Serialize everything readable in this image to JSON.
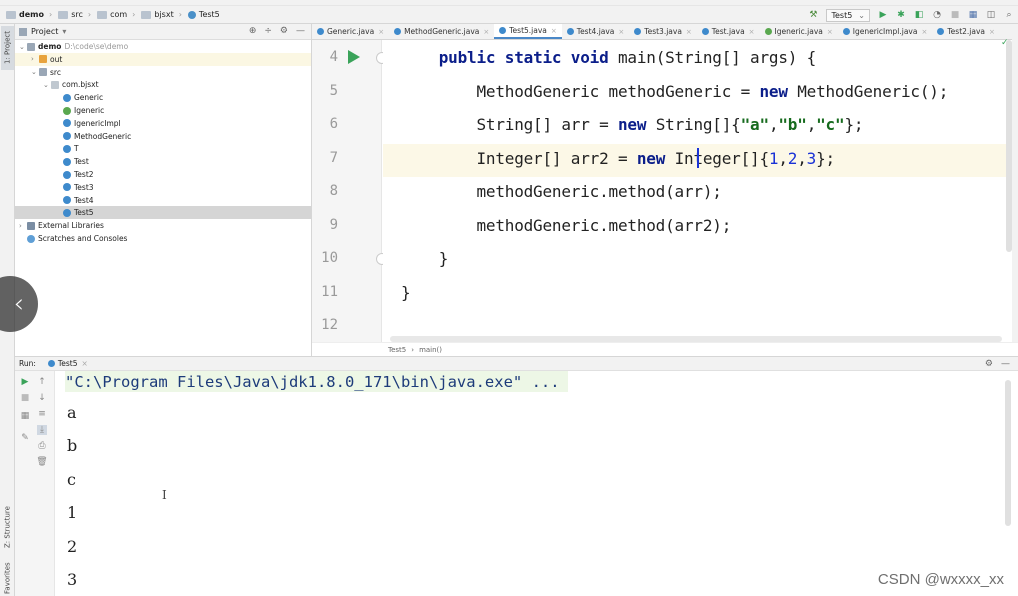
{
  "breadcrumb": [
    "demo",
    "src",
    "com",
    "bjsxt",
    "Test5"
  ],
  "run_config": "Test5",
  "project_panel": {
    "title": "Project",
    "tree": [
      {
        "label": "demo",
        "note": "D:\\code\\se\\demo",
        "depth": 0,
        "type": "folder",
        "expanded": true
      },
      {
        "label": "out",
        "depth": 1,
        "type": "ofolder",
        "expanded": false
      },
      {
        "label": "src",
        "depth": 1,
        "type": "folder",
        "expanded": true
      },
      {
        "label": "com.bjsxt",
        "depth": 2,
        "type": "pkg",
        "expanded": true
      },
      {
        "label": "Generic",
        "depth": 3,
        "type": "cls"
      },
      {
        "label": "Igeneric",
        "depth": 3,
        "type": "intf"
      },
      {
        "label": "IgenericImpl",
        "depth": 3,
        "type": "cls"
      },
      {
        "label": "MethodGeneric",
        "depth": 3,
        "type": "cls"
      },
      {
        "label": "T",
        "depth": 3,
        "type": "cls"
      },
      {
        "label": "Test",
        "depth": 3,
        "type": "cls"
      },
      {
        "label": "Test2",
        "depth": 3,
        "type": "cls"
      },
      {
        "label": "Test3",
        "depth": 3,
        "type": "cls"
      },
      {
        "label": "Test4",
        "depth": 3,
        "type": "cls"
      },
      {
        "label": "Test5",
        "depth": 3,
        "type": "cls",
        "selected": true
      },
      {
        "label": "External Libraries",
        "depth": 0,
        "type": "lib",
        "expanded": false
      },
      {
        "label": "Scratches and Consoles",
        "depth": 0,
        "type": "scr"
      }
    ]
  },
  "tabs": [
    {
      "label": "Generic.java",
      "icon": "class-icon"
    },
    {
      "label": "MethodGeneric.java",
      "icon": "class-icon"
    },
    {
      "label": "Test5.java",
      "icon": "class-icon",
      "active": true
    },
    {
      "label": "Test4.java",
      "icon": "class-icon"
    },
    {
      "label": "Test3.java",
      "icon": "class-icon"
    },
    {
      "label": "Test.java",
      "icon": "class-icon"
    },
    {
      "label": "Igeneric.java",
      "icon": "interface-icon"
    },
    {
      "label": "IgenericImpl.java",
      "icon": "class-icon"
    },
    {
      "label": "Test2.java",
      "icon": "class-icon"
    }
  ],
  "code_lines": [
    {
      "num": "4",
      "html": "    <span class=\"kw\">public static void</span> main(String[] args) {"
    },
    {
      "num": "5",
      "html": "        MethodGeneric methodGeneric = <span class=\"kw\">new</span> MethodGeneric();"
    },
    {
      "num": "6",
      "html": "        String[] arr = <span class=\"kw\">new</span> String[]{<span class=\"str\">\"a\"</span>,<span class=\"str\">\"b\"</span>,<span class=\"str\">\"c\"</span>};"
    },
    {
      "num": "7",
      "html": "        Integer[] arr2 = <span class=\"kw\">new</span> Integer[]{<span class=\"num\">1</span>,<span class=\"num\">2</span>,<span class=\"num\">3</span>};"
    },
    {
      "num": "8",
      "html": "        methodGeneric.method(arr);"
    },
    {
      "num": "9",
      "html": "        methodGeneric.method(arr2);"
    },
    {
      "num": "10",
      "html": "    }"
    },
    {
      "num": "11",
      "html": "}"
    },
    {
      "num": "12",
      "html": ""
    }
  ],
  "editor_breadcrumb": [
    "Test5",
    "main()"
  ],
  "run_panel": {
    "label": "Run:",
    "tab": "Test5",
    "command": "\"C:\\Program Files\\Java\\jdk1.8.0_171\\bin\\java.exe\" ...",
    "output": [
      "a",
      "b",
      "c",
      "1",
      "2",
      "3"
    ]
  },
  "side_tabs": {
    "project": "1: Project",
    "structure": "Z: Structure",
    "favorites": "2: Favorites"
  },
  "watermark": "CSDN @wxxxx_xx",
  "colors": {
    "keyword": "#0b1e8a",
    "string": "#176b1e",
    "number": "#1a32d6",
    "current_line": "#fcf8e7",
    "run_green": "#3aa35a"
  }
}
